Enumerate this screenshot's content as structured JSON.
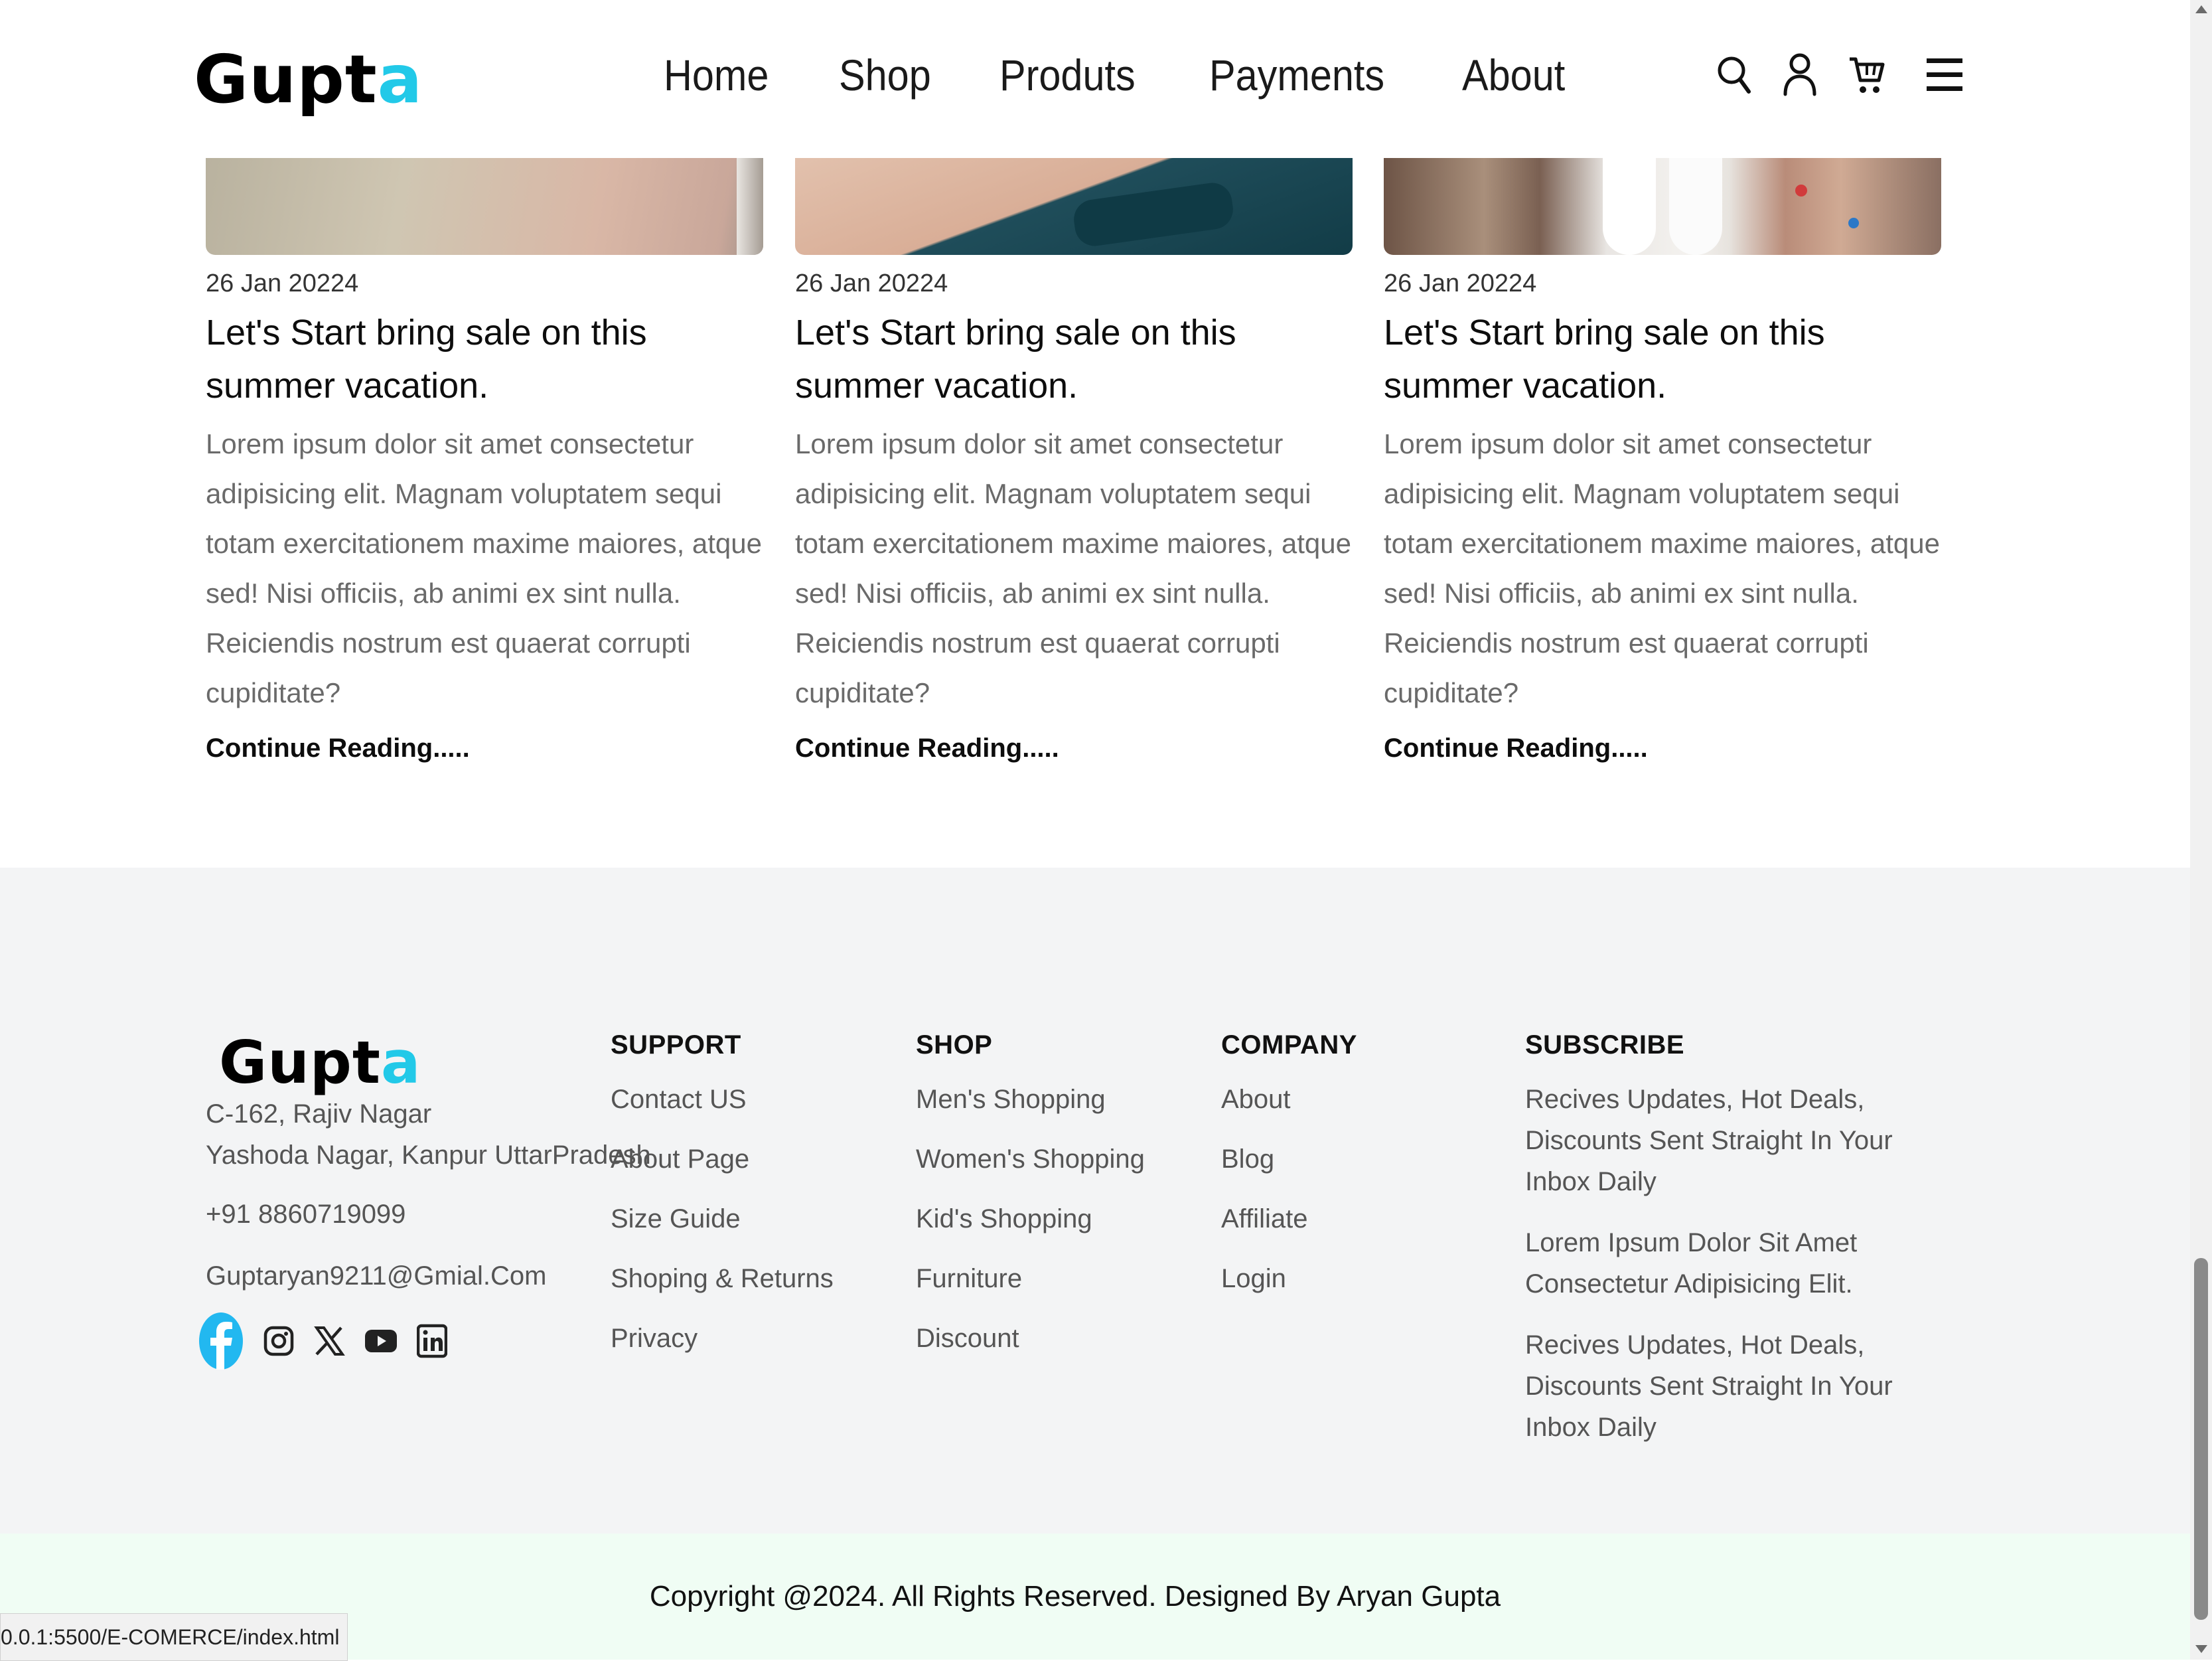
{
  "header": {
    "logo_main": "Gupt",
    "logo_accent": "a",
    "nav": [
      "Home",
      "Shop",
      "Produts",
      "Payments",
      "About"
    ],
    "icons": [
      "search-icon",
      "user-icon",
      "cart-icon",
      "menu-icon"
    ]
  },
  "blog": {
    "cards": [
      {
        "date": "26 Jan 20224",
        "title": "Let's Start bring sale on this summer vacation.",
        "body": "Lorem ipsum dolor sit amet consectetur adipisicing elit. Magnam voluptatem sequi totam exercitationem maxime maiores, atque sed! Nisi officiis, ab animi ex sint nulla. Reiciendis nostrum est quaerat corrupti cupiditate?",
        "more": "Continue Reading....."
      },
      {
        "date": "26 Jan 20224",
        "title": "Let's Start bring sale on this summer vacation.",
        "body": "Lorem ipsum dolor sit amet consectetur adipisicing elit. Magnam voluptatem sequi totam exercitationem maxime maiores, atque sed! Nisi officiis, ab animi ex sint nulla. Reiciendis nostrum est quaerat corrupti cupiditate?",
        "more": "Continue Reading....."
      },
      {
        "date": "26 Jan 20224",
        "title": "Let's Start bring sale on this summer vacation.",
        "body": "Lorem ipsum dolor sit amet consectetur adipisicing elit. Magnam voluptatem sequi totam exercitationem maxime maiores, atque sed! Nisi officiis, ab animi ex sint nulla. Reiciendis nostrum est quaerat corrupti cupiditate?",
        "more": "Continue Reading....."
      }
    ]
  },
  "footer": {
    "logo_main": "Gupt",
    "logo_accent": "a",
    "address_line1": "C-162, Rajiv Nagar",
    "address_line2": "Yashoda Nagar, Kanpur UttarPradesh",
    "phone": "+91 8860719099",
    "email": "Guptaryan9211@Gmial.Com",
    "social": [
      "facebook-icon",
      "instagram-icon",
      "x-icon",
      "youtube-icon",
      "linkedin-icon"
    ],
    "support": {
      "heading": "SUPPORT",
      "items": [
        "Contact US",
        "About Page",
        "Size Guide",
        "Shoping & Returns",
        "Privacy"
      ]
    },
    "shop": {
      "heading": "SHOP",
      "items": [
        "Men's Shopping",
        "Women's Shopping",
        "Kid's Shopping",
        "Furniture",
        "Discount"
      ]
    },
    "company": {
      "heading": "COMPANY",
      "items": [
        "About",
        "Blog",
        "Affiliate",
        "Login"
      ]
    },
    "subscribe": {
      "heading": "SUBSCRIBE",
      "items": [
        "Recives Updates, Hot Deals, Discounts Sent Straight In Your Inbox Daily",
        "Lorem Ipsum Dolor Sit Amet Consectetur Adipisicing Elit.",
        "Recives Updates, Hot Deals, Discounts Sent Straight In Your Inbox Daily"
      ]
    },
    "copyright": "Copyright @2024. All Rights Reserved. Designed By Aryan Gupta"
  },
  "status_url": "0.0.1:5500/E-COMERCE/index.html",
  "colors": {
    "accent": "#22c9e8",
    "facebook": "#1877f2",
    "footer_bg": "#f3f4f5",
    "copyright_bg": "#f0fdf4"
  }
}
